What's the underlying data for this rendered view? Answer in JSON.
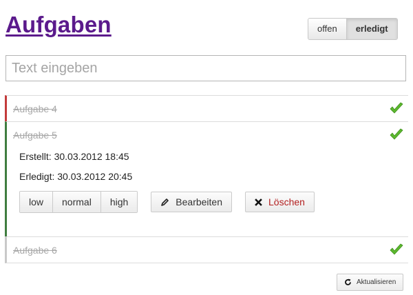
{
  "header": {
    "title": "Aufgaben"
  },
  "filters": [
    {
      "label": "offen",
      "active": false
    },
    {
      "label": "erledigt",
      "active": true
    }
  ],
  "input": {
    "placeholder": "Text eingeben",
    "value": ""
  },
  "tasks": [
    {
      "name": "Aufgabe 4",
      "done": true,
      "priority": "high",
      "priority_color": "#c33a3a",
      "expanded": false
    },
    {
      "name": "Aufgabe 5",
      "done": true,
      "priority": "normal",
      "priority_color": "#3f7d3f",
      "expanded": true,
      "created": "Erstellt: 30.03.2012 18:45",
      "completed": "Erledigt: 30.03.2012 20:45"
    },
    {
      "name": "Aufgabe 6",
      "done": true,
      "priority": "low",
      "priority_color": "#c9c9c9",
      "expanded": false
    }
  ],
  "priority_buttons": [
    "low",
    "normal",
    "high"
  ],
  "actions": {
    "edit": "Bearbeiten",
    "delete": "Löschen"
  },
  "refresh": {
    "label": "Aktualisieren"
  },
  "icons": {
    "done": "check-icon",
    "edit": "pencil-icon",
    "delete": "x-icon",
    "refresh": "refresh-icon"
  },
  "colors": {
    "title": "#5b1a8c",
    "check": "#5cb82e",
    "delete_text": "#b32020"
  }
}
